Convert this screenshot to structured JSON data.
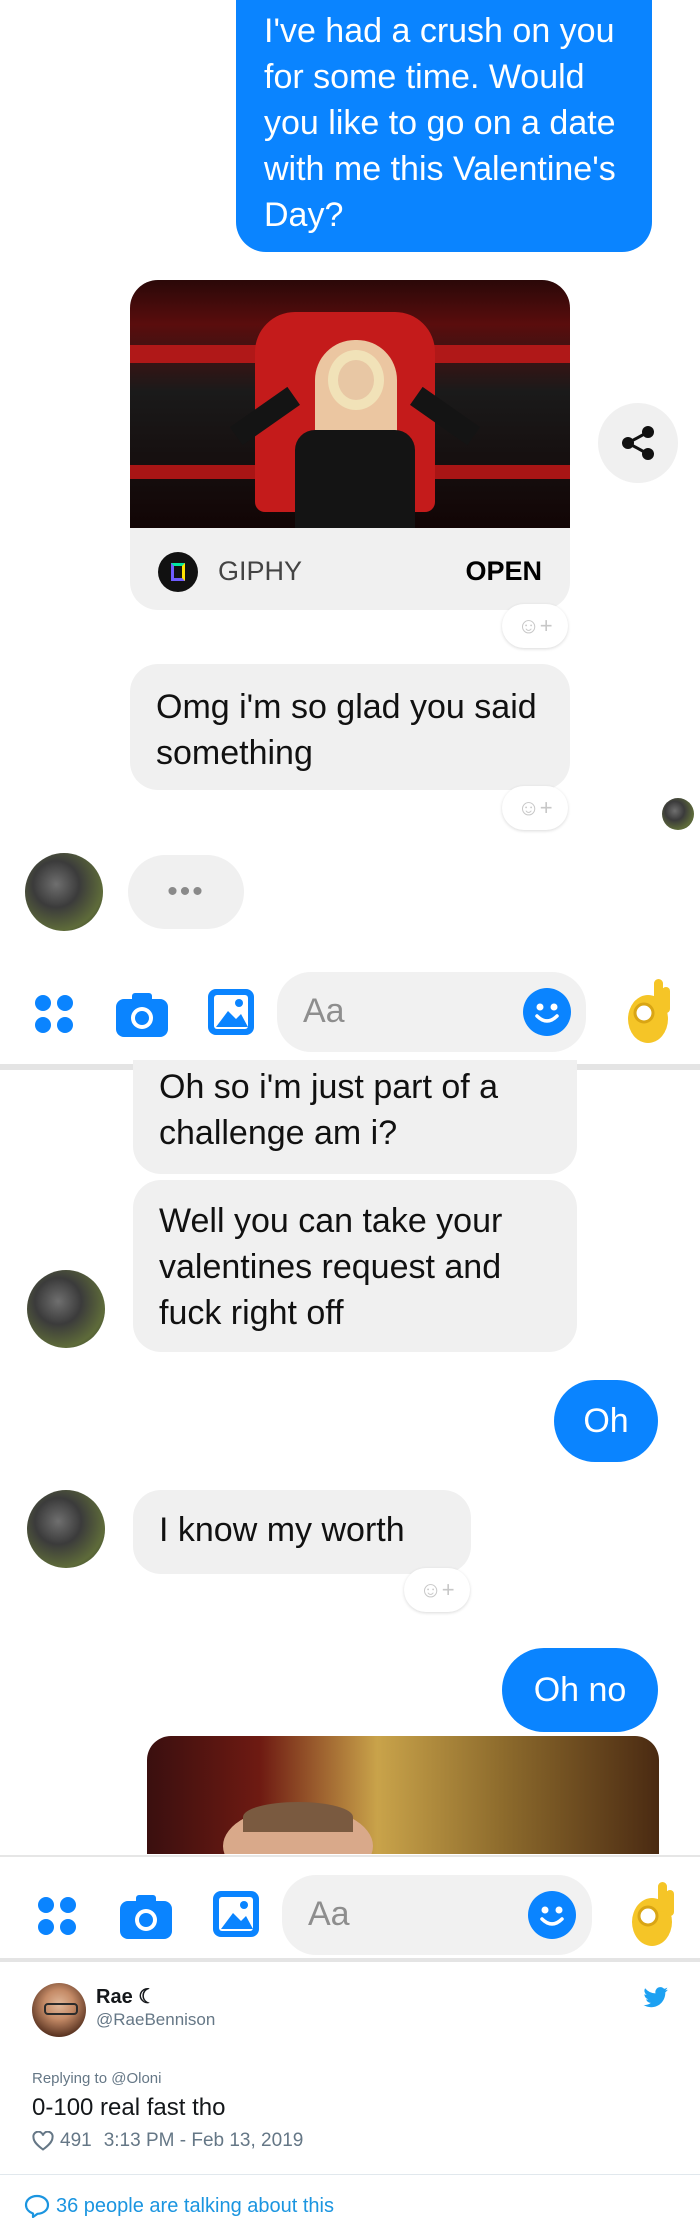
{
  "screen1": {
    "msg_out_1": "I've had a crush on you for some time. Would you like to go on a date with me this Valentine's Day?",
    "giphy_label": "GIPHY",
    "giphy_open": "OPEN",
    "msg_in_1": "Omg i'm so glad you said something",
    "typing": "•••",
    "input_placeholder": "Aa"
  },
  "screen2": {
    "msg_in_1": "Oh so i'm just part of a challenge am i?",
    "msg_in_2": "Well you can take your valentines request and fuck right off",
    "msg_out_1": "Oh",
    "msg_in_3": "I know my worth",
    "msg_out_2": "Oh no",
    "input_placeholder": "Aa"
  },
  "tweet": {
    "name": "Rae ☾",
    "handle": "@RaeBennison",
    "replying_to": "Replying to @Oloni",
    "text": "0-100 real fast tho",
    "likes": "491",
    "timestamp": "3:13 PM - Feb 13, 2019",
    "talking": "36 people are talking about this"
  },
  "colors": {
    "messenger_blue": "#0a84ff",
    "bubble_gray": "#f0f0f0",
    "twitter_blue": "#1da1f2",
    "ok_hand_yellow": "#f5c527"
  },
  "icons": [
    "menu-dots-icon",
    "camera-icon",
    "image-icon",
    "emoji-icon",
    "ok-hand-icon",
    "share-icon",
    "react-add-icon",
    "twitter-bird-icon",
    "heart-icon",
    "comment-bubble-icon"
  ]
}
